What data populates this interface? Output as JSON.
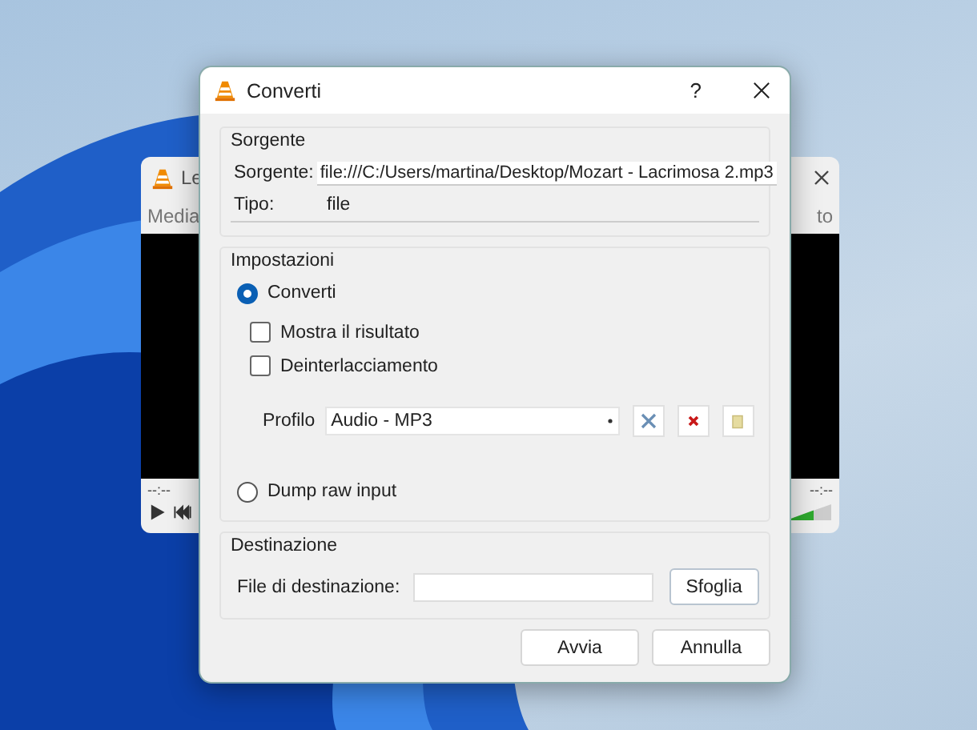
{
  "background_window": {
    "title": "Le",
    "menu": [
      "Media",
      "to"
    ],
    "time_elapsed": "--:--",
    "time_total": "--:--"
  },
  "dialog": {
    "title": "Converti",
    "help": "?",
    "source": {
      "legend": "Sorgente",
      "source_label": "Sorgente:",
      "source_value": "file:///C:/Users/martina/Desktop/Mozart - Lacrimosa 2.mp3",
      "type_label": "Tipo:",
      "type_value": "file"
    },
    "settings": {
      "legend": "Impostazioni",
      "modes": [
        {
          "label": "Converti",
          "selected": true
        },
        {
          "label": "Dump raw input",
          "selected": false
        }
      ],
      "options": [
        {
          "label": "Mostra il risultato",
          "checked": false
        },
        {
          "label": "Deinterlacciamento",
          "checked": false
        }
      ],
      "profile_label": "Profilo",
      "profile_value": "Audio - MP3"
    },
    "destination": {
      "legend": "Destinazione",
      "file_label": "File di destinazione:",
      "browse_button": "Sfoglia"
    },
    "buttons": [
      "Avvia",
      "Annulla"
    ]
  }
}
